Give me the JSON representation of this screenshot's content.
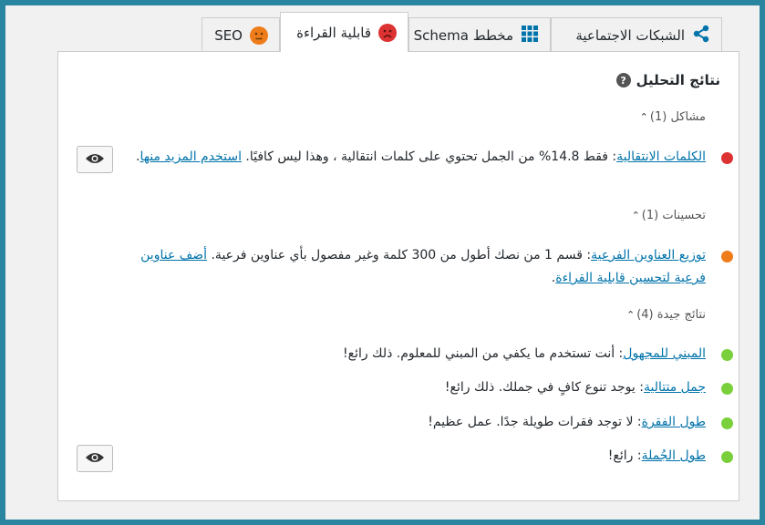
{
  "tabs": [
    {
      "key": "seo",
      "label": "SEO",
      "face": "neutral-face-icon",
      "color": "#ee7c1b"
    },
    {
      "key": "read",
      "label": "قابلية القراءة",
      "face": "sad-face-icon",
      "color": "#dc3232"
    },
    {
      "key": "schema",
      "label": "مخطط Schema",
      "icon": "grid-icon",
      "color": "#0073aa"
    },
    {
      "key": "social",
      "label": "الشبكات الاجتماعية",
      "icon": "share-icon",
      "color": "#0073aa"
    }
  ],
  "heading": "نتائج التحليل",
  "sections": {
    "problems": "مشاكل (1)",
    "improvements": "تحسينات (1)",
    "good": "نتائج جيدة (4)"
  },
  "items": {
    "transition": {
      "link": "الكلمات الانتقالية",
      "text": ": فقط 14.8% من الجمل تحتوي على كلمات انتقالية ، وهذا ليس كافيًا. ",
      "link2": "استخدم المزيد منها",
      "end": ".",
      "color": "#dc3232"
    },
    "subheading": {
      "link": "توزيع العناوين الفرعية",
      "text": ": قسم 1 من نصك أطول من 300 كلمة وغير مفصول بأي عناوين فرعية. ",
      "link2": "أضف عناوين فرعية لتحسين قابلية القراءة",
      "end": ".",
      "color": "#ee7c1b"
    },
    "passive": {
      "link": "المبني للمجهول",
      "text": ": أنت تستخدم ما يكفي من المبني للمعلوم. ذلك رائع!",
      "color": "#7ad03a"
    },
    "consecutive": {
      "link": "جمل متتالية",
      "text": ": يوجد تنوع كافٍ في جملك. ذلك رائع!",
      "color": "#7ad03a"
    },
    "paragraph": {
      "link": "طول الفقرة",
      "text": ": لا توجد فقرات طويلة جدًا. عمل عظيم!",
      "color": "#7ad03a"
    },
    "sentence": {
      "link": "طول الجُملة",
      "text": ": رائع!",
      "color": "#7ad03a"
    }
  }
}
